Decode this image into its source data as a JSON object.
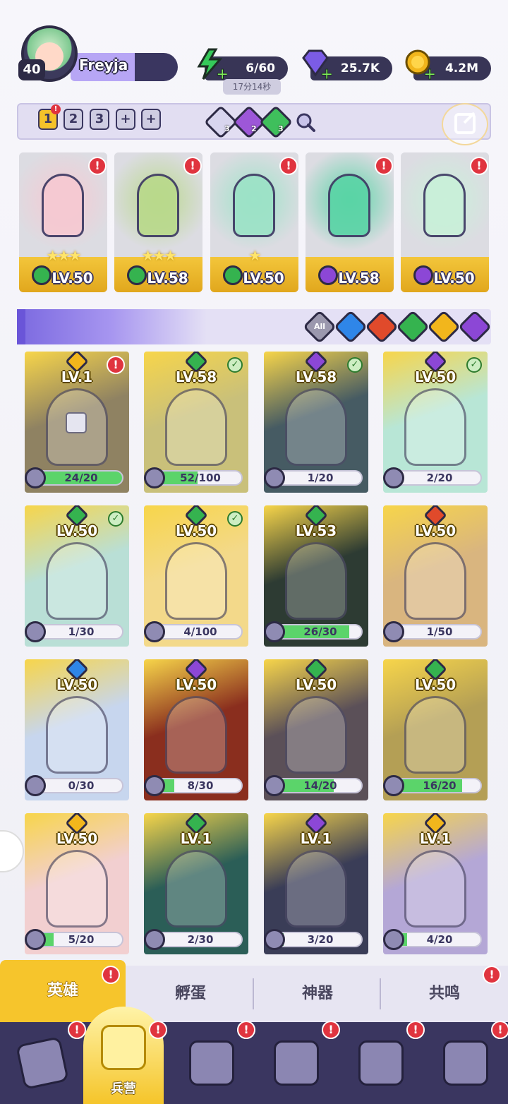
{
  "player": {
    "level": "40",
    "name": "Freyja"
  },
  "resources": [
    {
      "name": "energy",
      "icon": "lightning-icon",
      "value": "6/60",
      "color": "#35c95a"
    },
    {
      "name": "gems",
      "icon": "diamond-icon",
      "value": "25.7K",
      "color": "#7b5ce6"
    },
    {
      "name": "gold",
      "icon": "coin-icon",
      "value": "4.2M",
      "color": "#f2b61c"
    }
  ],
  "energy_timer": "17分14秒",
  "team_bar": {
    "slots": [
      "1",
      "2",
      "3",
      "+",
      "+"
    ],
    "active_slot": "1",
    "gems": [
      {
        "count": "3",
        "color": "#d8d5ee"
      },
      {
        "count": "2",
        "color": "#9d57d8"
      },
      {
        "count": "3",
        "color": "#3fbf5c"
      }
    ]
  },
  "team": [
    {
      "level": "LV.50",
      "element": "nature",
      "element_color": "#35b34f",
      "stars": "★★★",
      "art": "#f6c9d2"
    },
    {
      "level": "LV.58",
      "element": "nature",
      "element_color": "#35b34f",
      "stars": "★★★",
      "art": "#b9d98b"
    },
    {
      "level": "LV.50",
      "element": "nature",
      "element_color": "#35b34f",
      "stars": "★",
      "art": "#9ce3c7"
    },
    {
      "level": "LV.58",
      "element": "dark",
      "element_color": "#8c47d6",
      "stars": "",
      "art": "#5ad4a6"
    },
    {
      "level": "LV.50",
      "element": "dark",
      "element_color": "#8c47d6",
      "stars": "",
      "art": "#c9f0d9"
    }
  ],
  "filters": [
    {
      "label": "All",
      "color": "#9b98ae"
    },
    {
      "label": "",
      "color": "#2f86e8",
      "icon": "water-icon"
    },
    {
      "label": "",
      "color": "#e04a2b",
      "icon": "fire-icon"
    },
    {
      "label": "",
      "color": "#35b34f",
      "icon": "nature-icon"
    },
    {
      "label": "",
      "color": "#f2b61c",
      "icon": "light-icon"
    },
    {
      "label": "",
      "color": "#8c47d6",
      "icon": "dark-icon"
    }
  ],
  "heroes": [
    {
      "level": "LV.1",
      "progress": "24/20",
      "fill": 1.0,
      "element_color": "#f2b61c",
      "bg": "#8f8262",
      "locked": true,
      "status": "alert"
    },
    {
      "level": "LV.58",
      "progress": "52/100",
      "fill": 0.52,
      "element_color": "#35b34f",
      "bg": "#c9c07a",
      "status": "check"
    },
    {
      "level": "LV.58",
      "progress": "1/20",
      "fill": 0.05,
      "element_color": "#8c47d6",
      "bg": "#465b63",
      "status": "check"
    },
    {
      "level": "LV.50",
      "progress": "2/20",
      "fill": 0.1,
      "element_color": "#8c47d6",
      "bg": "#b8e6d6",
      "status": "check"
    },
    {
      "level": "LV.50",
      "progress": "1/30",
      "fill": 0.03,
      "element_color": "#35b34f",
      "bg": "#b9dfd6",
      "status": "check"
    },
    {
      "level": "LV.50",
      "progress": "4/100",
      "fill": 0.04,
      "element_color": "#35b34f",
      "bg": "#f3d98a",
      "status": "check"
    },
    {
      "level": "LV.53",
      "progress": "26/30",
      "fill": 0.87,
      "element_color": "#35b34f",
      "bg": "#2d3b33",
      "status": ""
    },
    {
      "level": "LV.50",
      "progress": "1/50",
      "fill": 0.02,
      "element_color": "#e04a2b",
      "bg": "#d9b57f",
      "status": ""
    },
    {
      "level": "LV.50",
      "progress": "0/30",
      "fill": 0.0,
      "element_color": "#2f86e8",
      "bg": "#c7d6ee",
      "status": ""
    },
    {
      "level": "LV.50",
      "progress": "8/30",
      "fill": 0.27,
      "element_color": "#8c47d6",
      "bg": "#8a2e1e",
      "status": ""
    },
    {
      "level": "LV.50",
      "progress": "14/20",
      "fill": 0.7,
      "element_color": "#35b34f",
      "bg": "#5b5058",
      "status": ""
    },
    {
      "level": "LV.50",
      "progress": "16/20",
      "fill": 0.8,
      "element_color": "#35b34f",
      "bg": "#b49f55",
      "status": ""
    },
    {
      "level": "LV.50",
      "progress": "5/20",
      "fill": 0.25,
      "element_color": "#f2b61c",
      "bg": "#f2cfd0",
      "status": ""
    },
    {
      "level": "LV.1",
      "progress": "2/30",
      "fill": 0.07,
      "element_color": "#35b34f",
      "bg": "#2b5e57",
      "status": ""
    },
    {
      "level": "LV.1",
      "progress": "3/20",
      "fill": 0.15,
      "element_color": "#8c47d6",
      "bg": "#3a3d57",
      "status": ""
    },
    {
      "level": "LV.1",
      "progress": "4/20",
      "fill": 0.2,
      "element_color": "#f2b61c",
      "bg": "#b4a7d6",
      "status": ""
    }
  ],
  "tabs": [
    {
      "label": "英雄",
      "active": true
    },
    {
      "label": "孵蛋",
      "active": false
    },
    {
      "label": "神器",
      "active": false
    },
    {
      "label": "共鸣",
      "active": false
    }
  ],
  "nav": [
    {
      "icon": "cards-icon",
      "label": ""
    },
    {
      "icon": "barracks-icon",
      "label": "兵营",
      "active": true
    },
    {
      "icon": "book-icon",
      "label": ""
    },
    {
      "icon": "castle-icon",
      "label": ""
    },
    {
      "icon": "mushroom-house-icon",
      "label": ""
    },
    {
      "icon": "guild-banner-icon",
      "label": ""
    }
  ]
}
